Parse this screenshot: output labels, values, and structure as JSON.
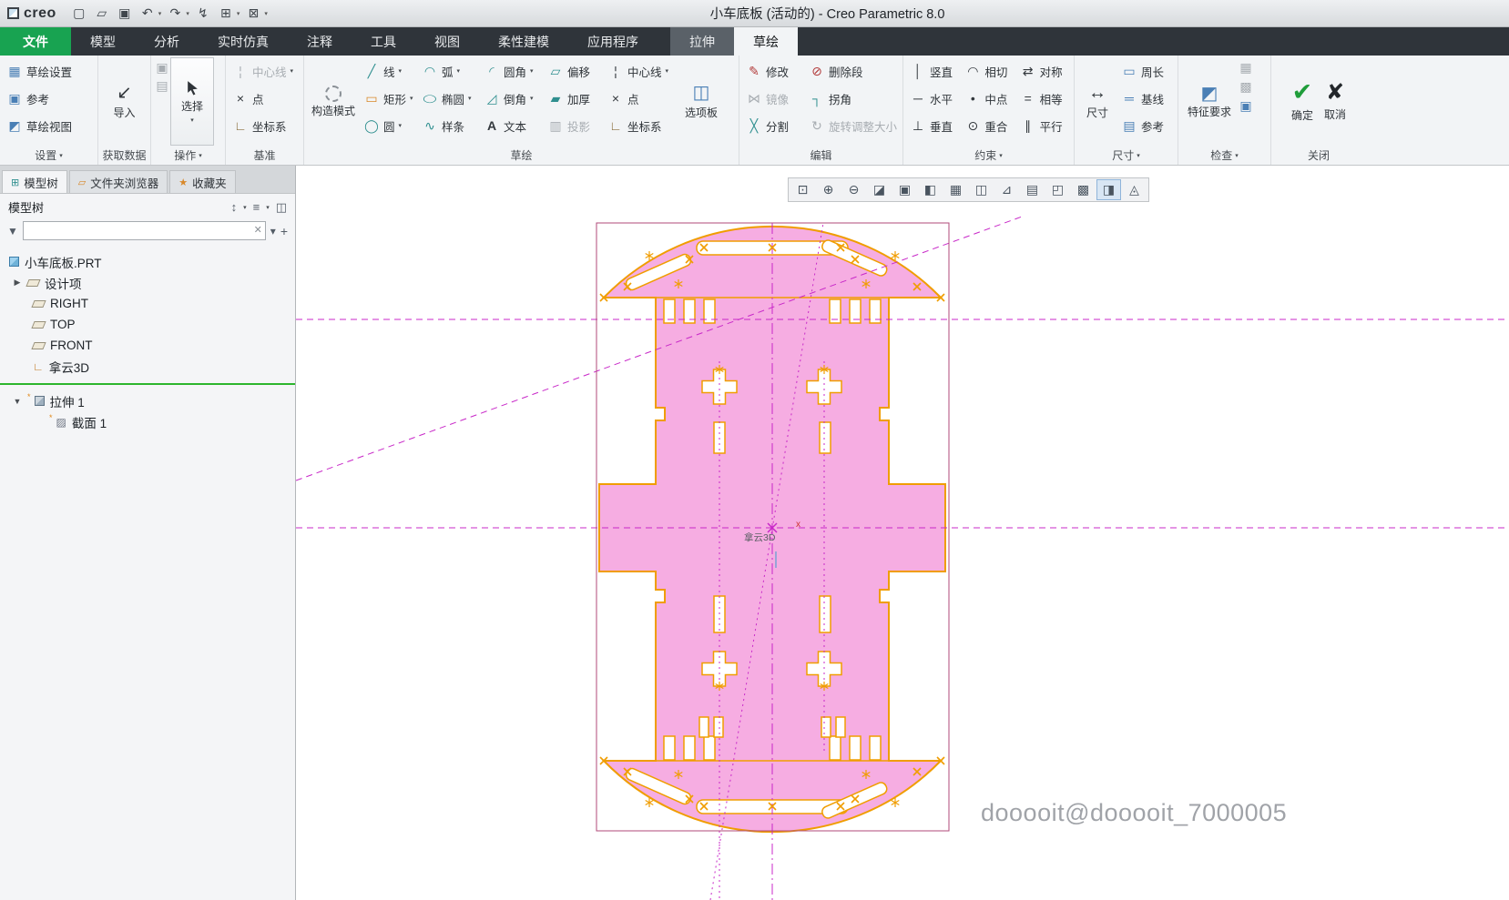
{
  "titlebar": {
    "logo": "creo",
    "title": "小车底板 (活动的) - Creo Parametric 8.0",
    "quick_icons": [
      "▢",
      "▱",
      "▣",
      "↶",
      "↷",
      "↯",
      "⊞",
      "⊠"
    ]
  },
  "tabs": {
    "file": "文件",
    "main": [
      "模型",
      "分析",
      "实时仿真",
      "注释",
      "工具",
      "视图",
      "柔性建模",
      "应用程序"
    ],
    "context": "拉伸",
    "active": "草绘"
  },
  "ribbon": {
    "settings": {
      "label": "设置",
      "items": [
        {
          "label": "草绘设置",
          "icon": "▦"
        },
        {
          "label": "参考",
          "icon": "▣"
        },
        {
          "label": "草绘视图",
          "icon": "◩"
        }
      ]
    },
    "getdata": {
      "label": "获取数据",
      "import_label": "导入",
      "import_icon": "↙"
    },
    "operations": {
      "label": "操作",
      "select_label": "选择",
      "copy_icon": "▣",
      "paste_icon": "▤"
    },
    "datum": {
      "label": "基准",
      "items": [
        {
          "label": "中心线",
          "icon": "¦"
        },
        {
          "label": "点",
          "icon": "×"
        },
        {
          "label": "坐标系",
          "icon": "∟"
        }
      ]
    },
    "sketch": {
      "label": "草绘",
      "construction": "构造模式",
      "col1": [
        {
          "label": "线",
          "icon": "╱"
        },
        {
          "label": "矩形",
          "icon": "▭"
        },
        {
          "label": "圆",
          "icon": "◯"
        }
      ],
      "col2": [
        {
          "label": "弧",
          "icon": "◠"
        },
        {
          "label": "椭圆",
          "icon": "◯"
        },
        {
          "label": "样条",
          "icon": "∿"
        }
      ],
      "col3": [
        {
          "label": "圆角",
          "icon": "◜"
        },
        {
          "label": "倒角",
          "icon": "◿"
        },
        {
          "label": "文本",
          "icon": "A"
        }
      ],
      "col4": [
        {
          "label": "偏移",
          "icon": "▱"
        },
        {
          "label": "加厚",
          "icon": "▰"
        },
        {
          "label": "投影",
          "icon": "▥"
        }
      ],
      "col5": [
        {
          "label": "中心线",
          "icon": "¦"
        },
        {
          "label": "点",
          "icon": "×"
        },
        {
          "label": "坐标系",
          "icon": "∟"
        }
      ],
      "palette": "选项板",
      "palette_icon": "◫"
    },
    "edit": {
      "label": "编辑",
      "col1": [
        {
          "label": "修改",
          "icon": "✎"
        },
        {
          "label": "镜像",
          "icon": "⋈"
        },
        {
          "label": "分割",
          "icon": "╳"
        }
      ],
      "col2": [
        {
          "label": "删除段",
          "icon": "⊘"
        },
        {
          "label": "拐角",
          "icon": "┐"
        },
        {
          "label": "旋转调整大小",
          "icon": "↻"
        }
      ]
    },
    "constrain": {
      "label": "约束",
      "col1": [
        {
          "label": "竖直",
          "icon": "│"
        },
        {
          "label": "水平",
          "icon": "─"
        },
        {
          "label": "垂直",
          "icon": "⊥"
        }
      ],
      "col2": [
        {
          "label": "相切",
          "icon": "◠"
        },
        {
          "label": "中点",
          "icon": "•"
        },
        {
          "label": "重合",
          "icon": "⊙"
        }
      ],
      "col3": [
        {
          "label": "对称",
          "icon": "⇄"
        },
        {
          "label": "相等",
          "icon": "="
        },
        {
          "label": "平行",
          "icon": "∥"
        }
      ]
    },
    "dimension": {
      "label": "尺寸",
      "main": "尺寸",
      "main_icon": "↔",
      "items": [
        {
          "label": "周长",
          "icon": "▭"
        },
        {
          "label": "基线",
          "icon": "═"
        },
        {
          "label": "参考",
          "icon": "▤"
        }
      ]
    },
    "inspect": {
      "label": "检查",
      "main": "特征要求",
      "main_icon": "◩",
      "small_icons": [
        "▦",
        "▩",
        "▣"
      ]
    },
    "close": {
      "label": "关闭",
      "ok": "确定",
      "ok_icon": "✔",
      "cancel": "取消",
      "cancel_icon": "✘"
    }
  },
  "panel": {
    "tabs": [
      "模型树",
      "文件夹浏览器",
      "收藏夹"
    ],
    "tab_icons": [
      "⊞",
      "▱",
      "★"
    ],
    "header": "模型树",
    "header_icons": [
      "↕",
      "≡",
      "◫"
    ],
    "filter_value": "",
    "tree": [
      {
        "label": "小车底板.PRT"
      },
      {
        "label": "设计项"
      },
      {
        "label": "RIGHT"
      },
      {
        "label": "TOP"
      },
      {
        "label": "FRONT"
      },
      {
        "label": "拿云3D"
      },
      {
        "label": "拉伸 1"
      },
      {
        "label": "截面 1"
      }
    ]
  },
  "canvas": {
    "toolbar_icons": [
      "⊡",
      "⊕",
      "⊖",
      "◪",
      "▣",
      "◧",
      "▦",
      "◫",
      "⊿",
      "▤",
      "◰",
      "▩",
      "◨",
      "◬"
    ],
    "origin_label": "拿云3D",
    "axis_x": "x",
    "watermark": "dooooit@dooooit_7000005"
  }
}
